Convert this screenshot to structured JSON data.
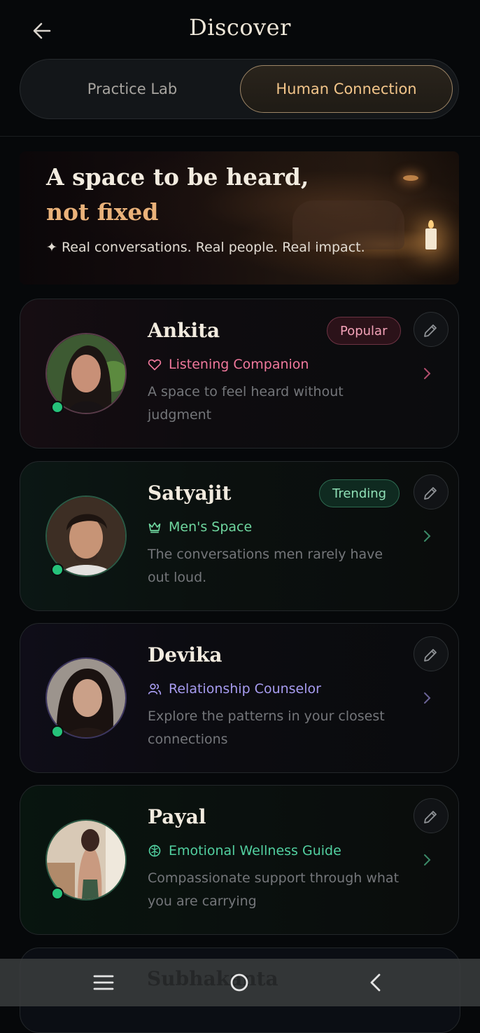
{
  "header": {
    "title": "Discover",
    "back_icon": "arrow-left-icon"
  },
  "segmented": {
    "tabs": [
      {
        "label": "Practice Lab",
        "selected": false
      },
      {
        "label": "Human Connection",
        "selected": true
      }
    ]
  },
  "hero": {
    "title_line1": "A space to be heard,",
    "title_line2": "not fixed",
    "subtitle": "✦ Real conversations. Real people. Real impact."
  },
  "cards": [
    {
      "name": "Ankita",
      "badge": "Popular",
      "role": "Listening Companion",
      "role_icon": "heart-icon",
      "role_color": "#f0789c",
      "description": "A space to feel heard without judgment",
      "online": true
    },
    {
      "name": "Satyajit",
      "badge": "Trending",
      "role": "Men's Space",
      "role_icon": "crown-icon",
      "role_color": "#6fd79f",
      "description": "The conversations men rarely have out loud.",
      "online": true
    },
    {
      "name": "Devika",
      "badge": "",
      "role": "Relationship Counselor",
      "role_icon": "users-icon",
      "role_color": "#a79cf0",
      "description": "Explore the patterns in your closest connections",
      "online": true
    },
    {
      "name": "Payal",
      "badge": "",
      "role": "Emotional Wellness Guide",
      "role_icon": "brain-icon",
      "role_color": "#52d0a0",
      "description": "Compassionate support through what you are carrying",
      "online": true
    }
  ],
  "next_card_peek": {
    "name": "Subhakanta"
  },
  "nav": {
    "icons": [
      "menu-icon",
      "home-circle-icon",
      "back-chevron-icon"
    ]
  }
}
